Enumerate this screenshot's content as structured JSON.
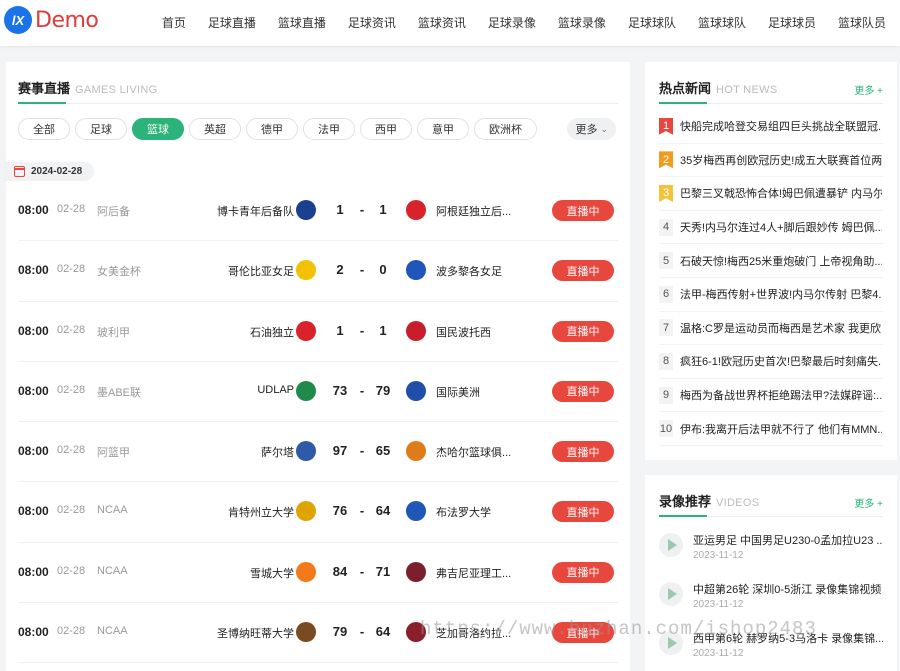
{
  "logo": {
    "mark": "lX",
    "text": "Demo"
  },
  "nav": [
    "首页",
    "足球直播",
    "篮球直播",
    "足球资讯",
    "篮球资讯",
    "足球录像",
    "篮球录像",
    "足球球队",
    "篮球球队",
    "足球球员",
    "篮球队员"
  ],
  "games": {
    "title": "赛事直播",
    "subtitle": "GAMES LIVING",
    "filters": [
      "全部",
      "足球",
      "篮球",
      "英超",
      "德甲",
      "法甲",
      "西甲",
      "意甲",
      "欧洲杯"
    ],
    "active_filter": "篮球",
    "more": "更多",
    "date": "2024-02-28",
    "matches": [
      {
        "time": "08:00",
        "date": "02-28",
        "league": "阿后备",
        "home": "博卡青年后备队",
        "home_score": "1",
        "dash": "-",
        "away_score": "1",
        "away": "阿根廷独立后...",
        "status": "直播中",
        "home_color": "#1d3f8f",
        "away_color": "#d8232a"
      },
      {
        "time": "08:00",
        "date": "02-28",
        "league": "女美金杯",
        "home": "哥伦比亚女足",
        "home_score": "2",
        "dash": "-",
        "away_score": "0",
        "away": "波多黎各女足",
        "status": "直播中",
        "home_color": "#f2c100",
        "away_color": "#1f56b8"
      },
      {
        "time": "08:00",
        "date": "02-28",
        "league": "玻利甲",
        "home": "石油独立",
        "home_score": "1",
        "dash": "-",
        "away_score": "1",
        "away": "国民波托西",
        "status": "直播中",
        "home_color": "#d8232a",
        "away_color": "#c81e2c"
      },
      {
        "time": "08:00",
        "date": "02-28",
        "league": "墨ABE联",
        "home": "UDLAP",
        "home_score": "73",
        "dash": "-",
        "away_score": "79",
        "away": "国际美洲",
        "status": "直播中",
        "home_color": "#1f8a4c",
        "away_color": "#1f4fa8"
      },
      {
        "time": "08:00",
        "date": "02-28",
        "league": "阿篮甲",
        "home": "萨尔塔",
        "home_score": "97",
        "dash": "-",
        "away_score": "65",
        "away": "杰哈尔篮球俱...",
        "status": "直播中",
        "home_color": "#2e5aa8",
        "away_color": "#e07b1a"
      },
      {
        "time": "08:00",
        "date": "02-28",
        "league": "NCAA",
        "home": "肯特州立大学",
        "home_score": "76",
        "dash": "-",
        "away_score": "64",
        "away": "布法罗大学",
        "status": "直播中",
        "home_color": "#e0a400",
        "away_color": "#1f56b8"
      },
      {
        "time": "08:00",
        "date": "02-28",
        "league": "NCAA",
        "home": "雪城大学",
        "home_score": "84",
        "dash": "-",
        "away_score": "71",
        "away": "弗吉尼亚理工...",
        "status": "直播中",
        "home_color": "#f27a1a",
        "away_color": "#7a1f2b"
      },
      {
        "time": "08:00",
        "date": "02-28",
        "league": "NCAA",
        "home": "圣博纳旺蒂大学",
        "home_score": "79",
        "dash": "-",
        "away_score": "64",
        "away": "芝加哥洛约拉...",
        "status": "直播中",
        "home_color": "#7a4a22",
        "away_color": "#8a1f2b"
      }
    ]
  },
  "hot_news": {
    "title": "热点新闻",
    "subtitle": "HOT NEWS",
    "more": "更多 +",
    "items": [
      {
        "rank": "1",
        "text": "快船完成哈登交易组四巨头挑战全联盟冠..."
      },
      {
        "rank": "2",
        "text": "35岁梅西再创欧冠历史!成五大联赛首位两..."
      },
      {
        "rank": "3",
        "text": "巴黎三叉戟恐怖合体!姆巴佩遭暴铲 内马尔..."
      },
      {
        "rank": "4",
        "text": "天秀!内马尔连过4人+脚后跟妙传 姆巴佩..."
      },
      {
        "rank": "5",
        "text": "石破天惊!梅西25米重炮破门 上帝视角助..."
      },
      {
        "rank": "6",
        "text": "法甲-梅西传射+世界波!内马尔传射 巴黎4..."
      },
      {
        "rank": "7",
        "text": "温格:C罗是运动员而梅西是艺术家 我更欣..."
      },
      {
        "rank": "8",
        "text": "疯狂6-1!欧冠历史首次!巴黎最后时刻痛失..."
      },
      {
        "rank": "9",
        "text": "梅西为备战世界杯拒绝踢法甲?法媒辟谣:..."
      },
      {
        "rank": "10",
        "text": "伊布:我离开后法甲就不行了 他们有MMN..."
      }
    ]
  },
  "videos": {
    "title": "录像推荐",
    "subtitle": "VIDEOS",
    "more": "更多 +",
    "items": [
      {
        "title": "亚运男足 中国男足U230-0孟加拉U23 ...",
        "date": "2023-11-12"
      },
      {
        "title": "中超第26轮 深圳0-5浙江 录像集锦视频",
        "date": "2023-11-12"
      },
      {
        "title": "西甲第6轮 赫罗纳5-3马洛卡 录像集锦...",
        "date": "2023-11-12"
      }
    ]
  },
  "watermark": "https://www.huzhan.com/ishop2483"
}
